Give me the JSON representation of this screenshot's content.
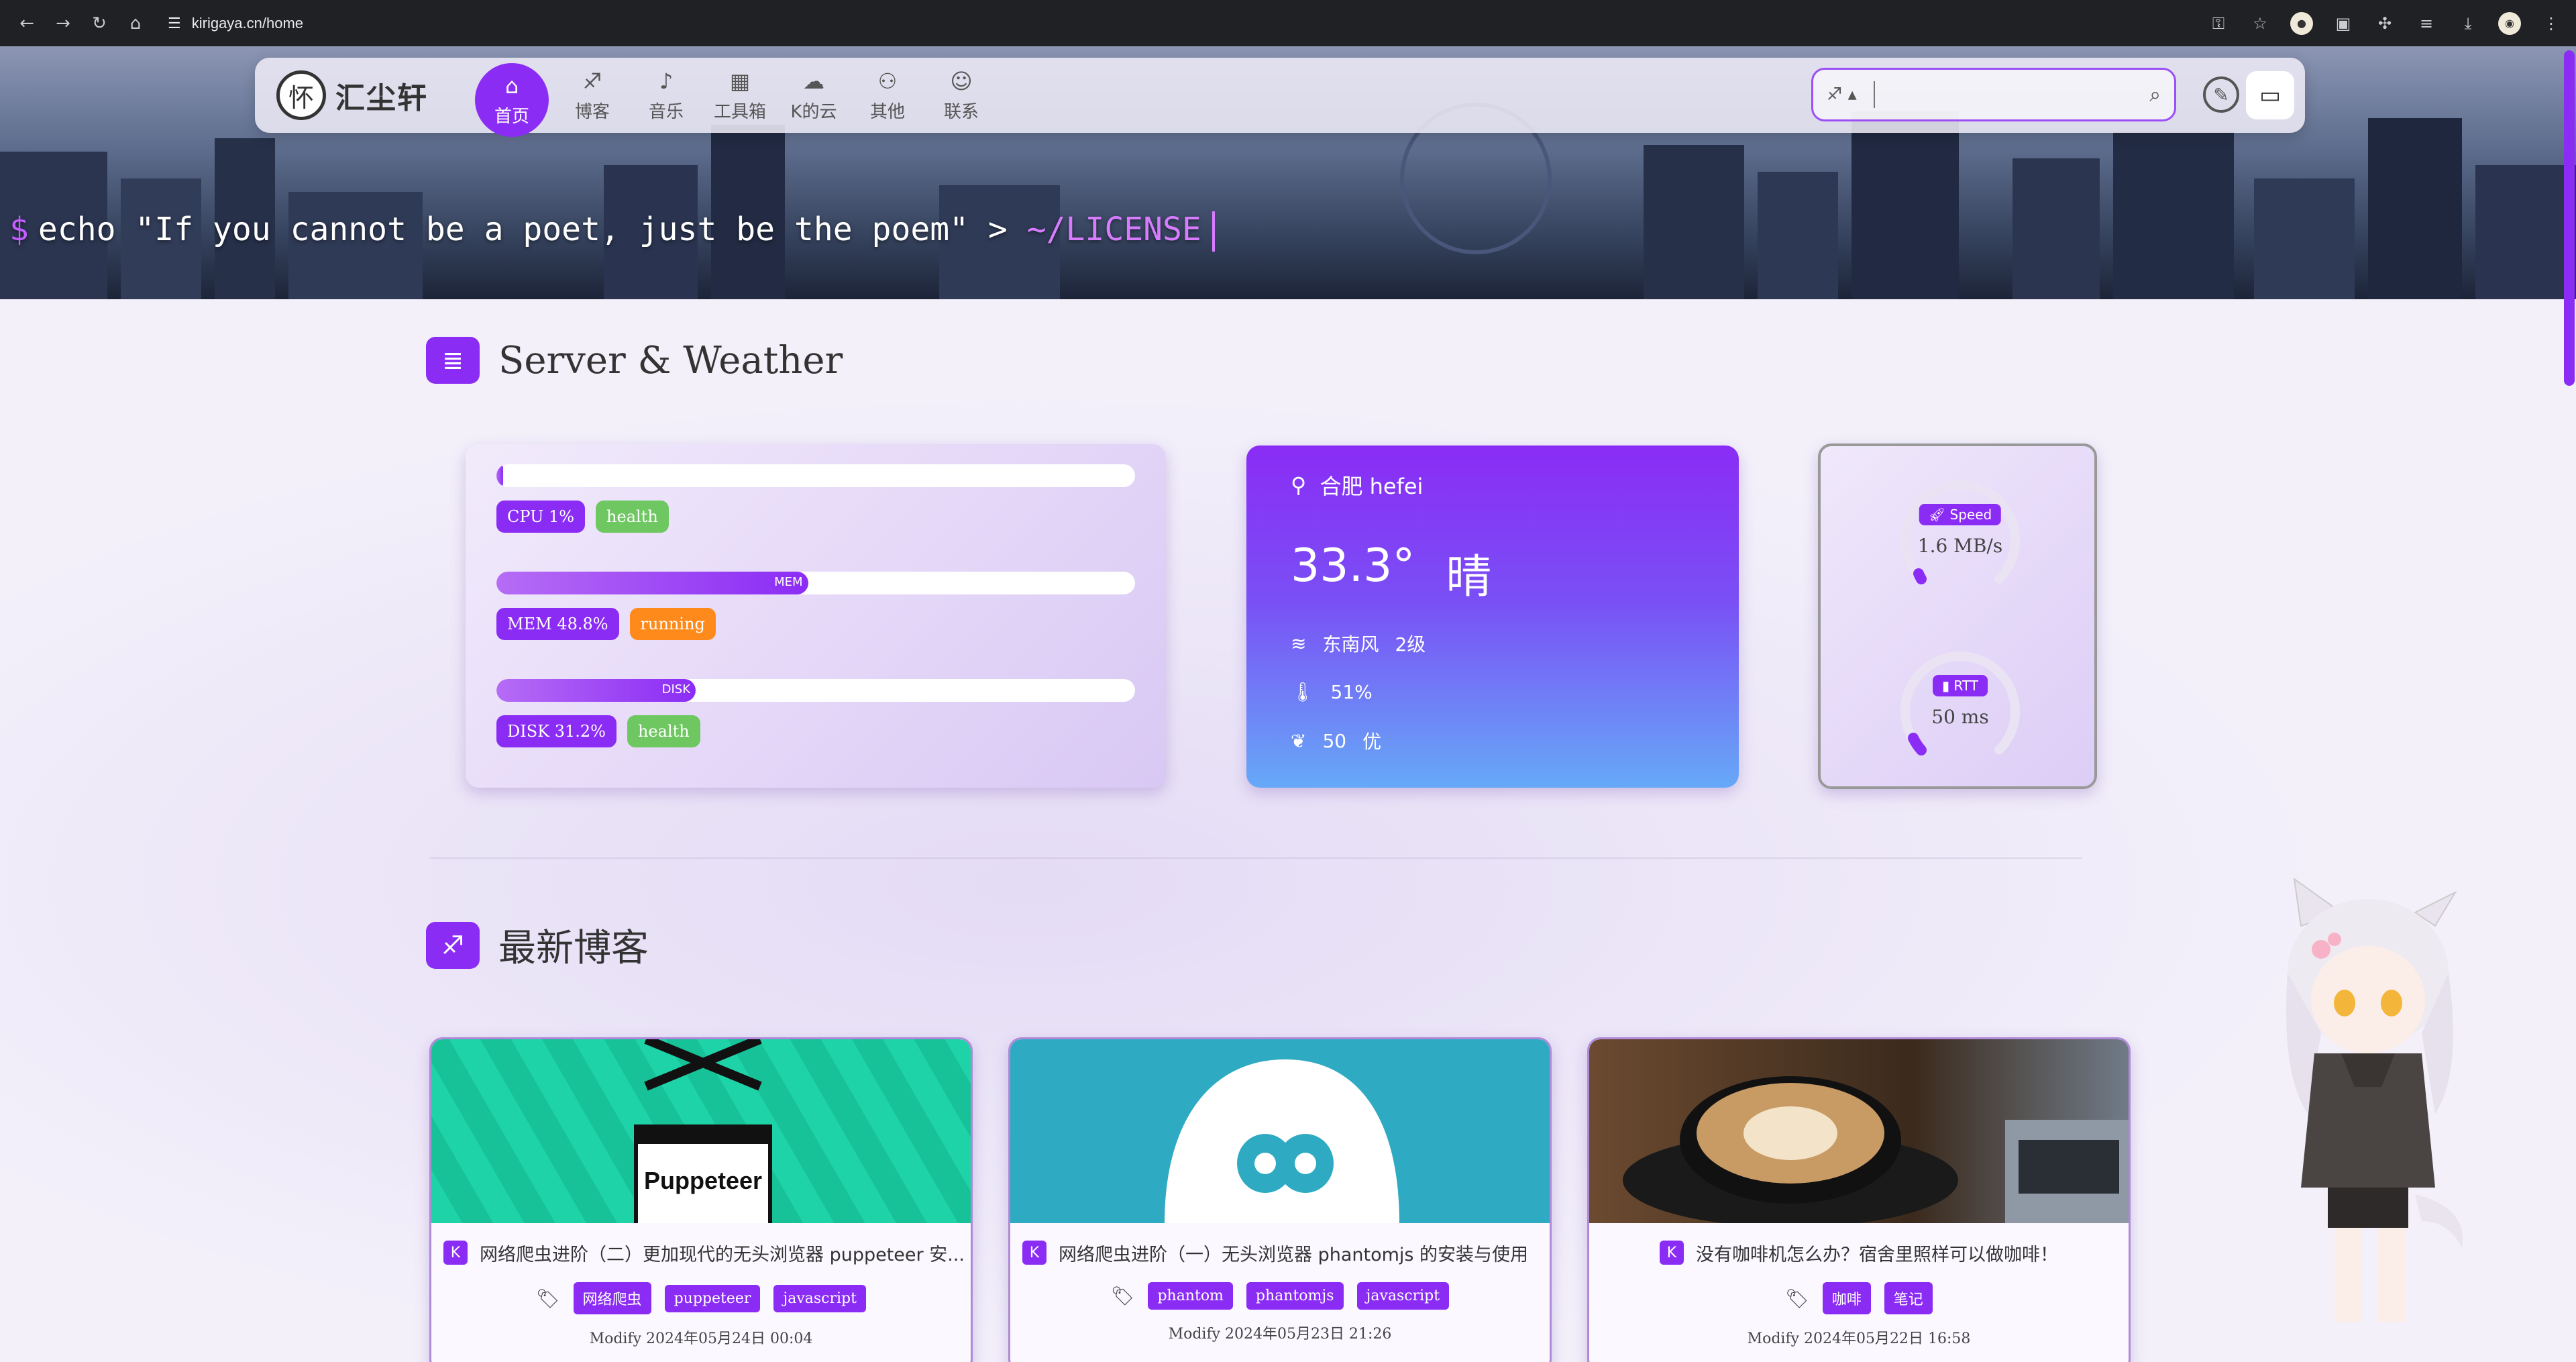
{
  "browser": {
    "url": "kirigaya.cn/home"
  },
  "nav": {
    "logo_text": "汇尘轩",
    "items": [
      {
        "label": "首页",
        "icon": "home-icon",
        "glyph": "⌂"
      },
      {
        "label": "博客",
        "icon": "blog-icon",
        "glyph": "♐"
      },
      {
        "label": "音乐",
        "icon": "guitar-icon",
        "glyph": "♪"
      },
      {
        "label": "工具箱",
        "icon": "grid-icon",
        "glyph": "▦"
      },
      {
        "label": "K的云",
        "icon": "cloud-icon",
        "glyph": "☁"
      },
      {
        "label": "其他",
        "icon": "binoculars-icon",
        "glyph": "⚇"
      },
      {
        "label": "联系",
        "icon": "contact-icon",
        "glyph": "☺"
      }
    ],
    "search_placeholder": ""
  },
  "hero": {
    "cmd_prefix": "$",
    "cmd_text": "echo \"If you cannot be a poet, just be the poem\" >",
    "cmd_path": "~/LICENSE"
  },
  "server_section": {
    "title": "Server & Weather",
    "cpu": {
      "label": "CPU 1%",
      "status": "health",
      "fraction": 0.01,
      "bar_text": ""
    },
    "mem": {
      "label": "MEM 48.8%",
      "status": "running",
      "fraction": 0.488,
      "bar_text": "MEM"
    },
    "disk": {
      "label": "DISK 31.2%",
      "status": "health",
      "fraction": 0.312,
      "bar_text": "DISK"
    }
  },
  "weather": {
    "city": "合肥 hefei",
    "temp": "33.3°",
    "condition": "晴",
    "wind": "东南风",
    "wind_level": "2级",
    "humidity": "51%",
    "aqi": "50",
    "aqi_level": "优"
  },
  "network": {
    "speed_label": "Speed",
    "speed_value": "1.6 MB/s",
    "rtt_label": "RTT",
    "rtt_value": "50 ms"
  },
  "blog_section": {
    "title": "最新博客",
    "posts": [
      {
        "title": "网络爬虫进阶（二）更加现代的无头浏览器 puppeteer 安...",
        "tags": [
          "网络爬虫",
          "puppeteer",
          "javascript"
        ],
        "modified": "Modify 2024年05月24日 00:04",
        "cover_text": "Puppeteer"
      },
      {
        "title": "网络爬虫进阶（一）无头浏览器 phantomjs 的安装与使用",
        "tags": [
          "phantom",
          "phantomjs",
          "javascript"
        ],
        "modified": "Modify 2024年05月23日 21:26",
        "cover_text": ""
      },
      {
        "title": "没有咖啡机怎么办？宿舍里照样可以做咖啡！",
        "tags": [
          "咖啡",
          "笔记"
        ],
        "modified": "Modify 2024年05月22日 16:58",
        "cover_text": ""
      }
    ]
  },
  "colors": {
    "accent": "#8b2cf5",
    "health": "#6fc761",
    "running": "#ff8a1c"
  }
}
